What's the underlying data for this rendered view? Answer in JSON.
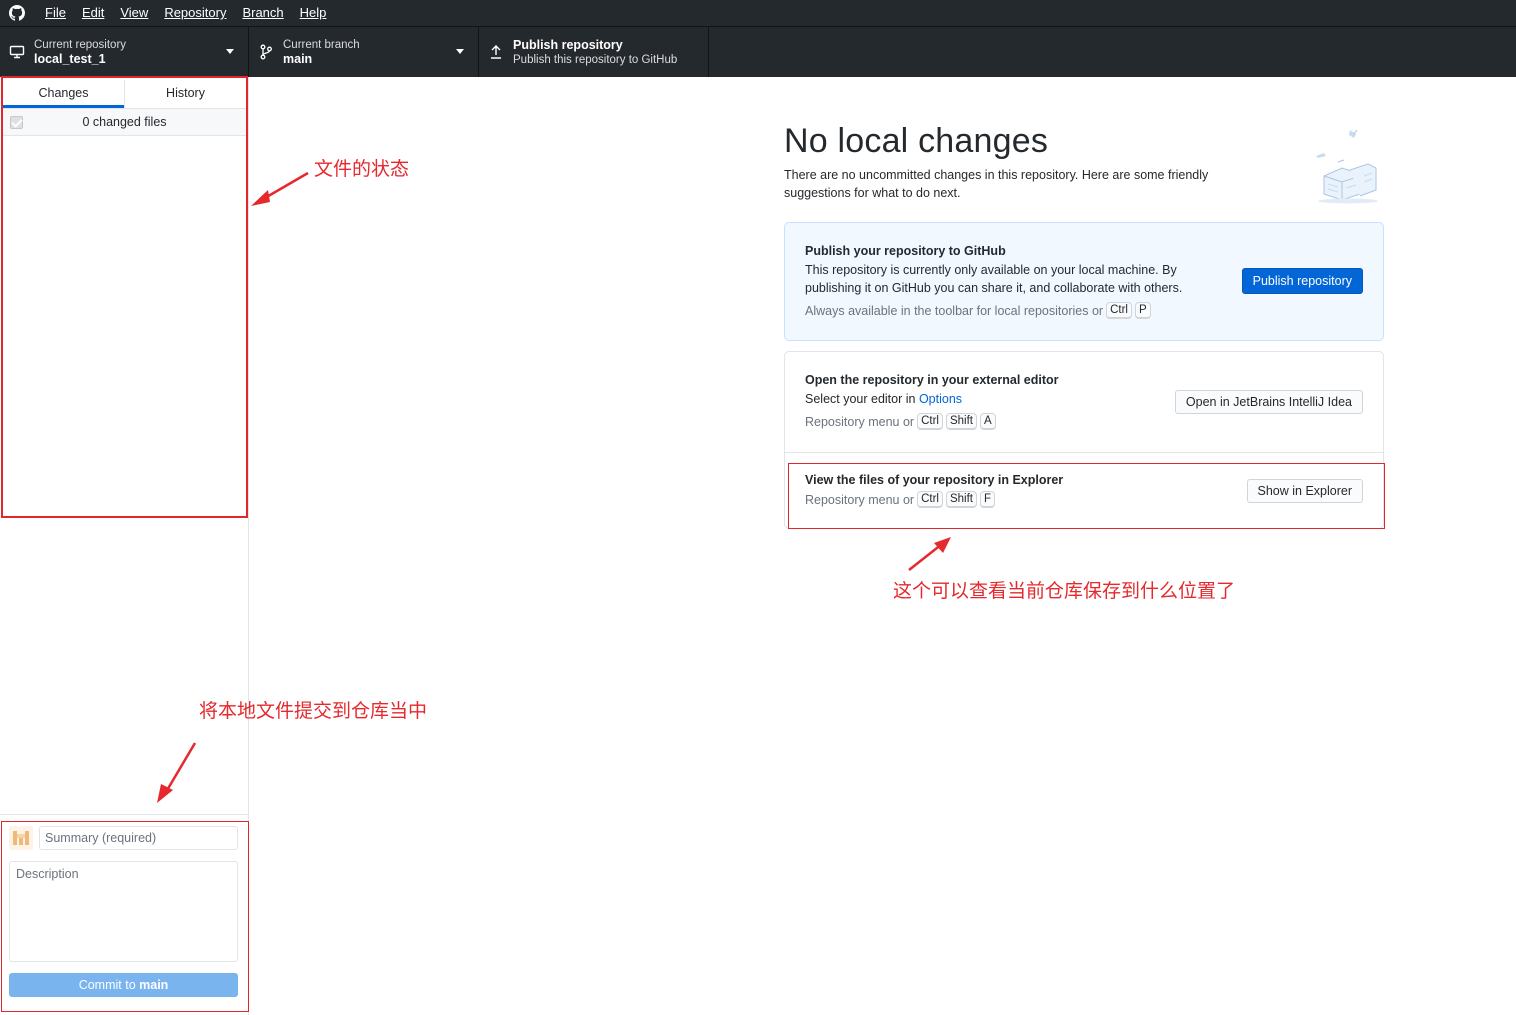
{
  "menu": {
    "items": [
      {
        "label": "File"
      },
      {
        "label": "Edit"
      },
      {
        "label": "View"
      },
      {
        "label": "Repository"
      },
      {
        "label": "Branch"
      },
      {
        "label": "Help"
      }
    ]
  },
  "toolbar": {
    "repository": {
      "label": "Current repository",
      "value": "local_test_1",
      "icon": "computer-icon"
    },
    "branch": {
      "label": "Current branch",
      "value": "main",
      "icon": "branch-icon"
    },
    "publish": {
      "label": "Publish repository",
      "sublabel": "Publish this repository to GitHub",
      "icon": "upload-icon"
    }
  },
  "sidebar": {
    "tabs": [
      {
        "label": "Changes",
        "active": true
      },
      {
        "label": "History",
        "active": false
      }
    ],
    "changed_files": "0 changed files",
    "commit": {
      "summary_placeholder": "Summary (required)",
      "description_placeholder": "Description",
      "button_prefix": "Commit to ",
      "button_branch": "main"
    }
  },
  "main": {
    "title": "No local changes",
    "description": "There are no uncommitted changes in this repository. Here are some friendly suggestions for what to do next.",
    "publish_card": {
      "title": "Publish your repository to GitHub",
      "text": "This repository is currently only available on your local machine. By publishing it on GitHub you can share it, and collaborate with others.",
      "hint": "Always available in the toolbar for local repositories or",
      "keys": [
        "Ctrl",
        "P"
      ],
      "button": "Publish repository"
    },
    "editor_card": {
      "title": "Open the repository in your external editor",
      "text_prefix": "Select your editor in ",
      "text_link": "Options",
      "hint": "Repository menu or",
      "keys": [
        "Ctrl",
        "Shift",
        "A"
      ],
      "button": "Open in JetBrains IntelliJ Idea"
    },
    "explorer_card": {
      "title": "View the files of your repository in Explorer",
      "hint": "Repository menu or",
      "keys": [
        "Ctrl",
        "Shift",
        "F"
      ],
      "button": "Show in Explorer"
    }
  },
  "annotations": {
    "file_status": "文件的状态",
    "explorer_location": "这个可以查看当前仓库保存到什么位置了",
    "commit_to_repo": "将本地文件提交到仓库当中"
  },
  "colors": {
    "toolbar_bg": "#24292e",
    "accent": "#0366d6",
    "annotation_red": "#e0282c",
    "commit_button_disabled": "#79b4ef"
  }
}
